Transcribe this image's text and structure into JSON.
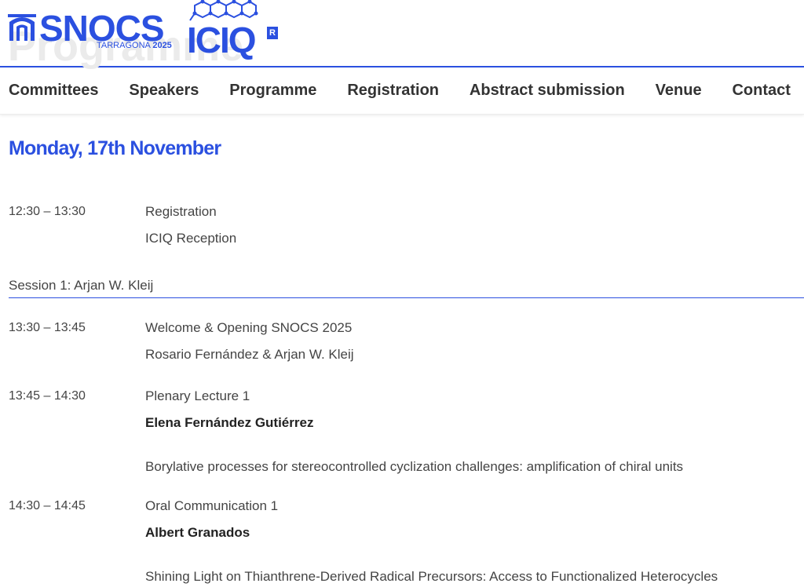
{
  "header": {
    "ghost_title": "Programme",
    "logo_snocs": {
      "name": "SNOCS",
      "location": "TARRAGONA",
      "year": "2025"
    },
    "logo_iciq": {
      "name": "ICIQ",
      "badge": "R"
    }
  },
  "nav": {
    "items": [
      "Committees",
      "Speakers",
      "Programme",
      "Registration",
      "Abstract submission",
      "Venue",
      "Contact"
    ]
  },
  "programme": {
    "day_title": "Monday, 17th November",
    "registration": {
      "time": "12:30 – 13:30",
      "line1": "Registration",
      "line2": "ICIQ Reception"
    },
    "session_title": "Session 1: Arjan W. Kleij",
    "welcome": {
      "time": "13:30 – 13:45",
      "line1": "Welcome & Opening SNOCS 2025",
      "line2": "Rosario Fernández & Arjan W. Kleij"
    },
    "plenary": {
      "time": "13:45 – 14:30",
      "type": "Plenary Lecture 1",
      "speaker": "Elena Fernández Gutiérrez",
      "talk": "Borylative processes for stereocontrolled cyclization challenges: amplification of chiral units"
    },
    "oral": {
      "time": "14:30 – 14:45",
      "type": "Oral Communication 1",
      "speaker": "Albert Granados",
      "talk": "Shining Light on Thianthrene-Derived Radical Precursors: Access to Functionalized Heterocycles"
    }
  },
  "colors": {
    "accent": "#2b50e0",
    "text": "#444444",
    "ghost": "#ebebeb"
  }
}
